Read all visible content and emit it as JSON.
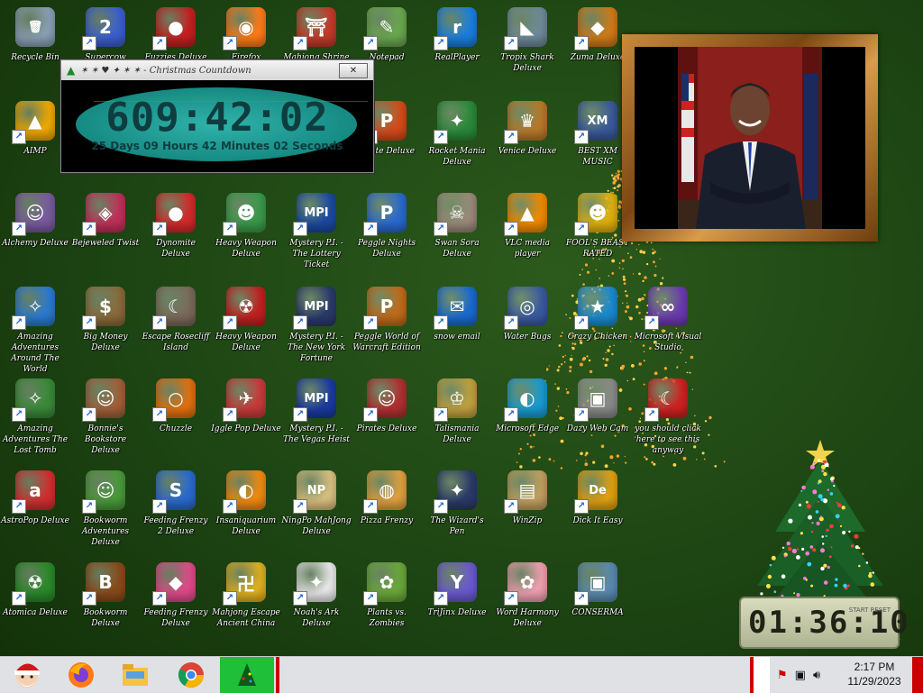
{
  "colors": {
    "desktop_bg": "#1d4413",
    "countdown_accent": "#168a83",
    "taskbar_bg": "#dfe1e5",
    "taskbar_active": "#1fbf3a",
    "frame_gold": "#b8792a"
  },
  "countdown_window": {
    "title": "✶ ✶ ♥ ✦ ✶ ✶ - Christmas Countdown",
    "close_label": "✕",
    "time": "609:42:02",
    "subtitle": "25 Days 09 Hours 42 Minutes 02 Seconds"
  },
  "desktop_icons": [
    {
      "label": "Recycle Bin",
      "icon": "recycle-bin-icon",
      "color": "#8aa0b5",
      "glyph": "🗑"
    },
    {
      "label": "Supercow Deluxe",
      "icon": "two-app-icon",
      "color": "#3b5fd0",
      "glyph": "2"
    },
    {
      "label": "Fuzzies Deluxe",
      "icon": "red-fuzzy-icon",
      "color": "#c52020",
      "glyph": "●"
    },
    {
      "label": "Firefox",
      "icon": "firefox-icon",
      "color": "#ff7a18",
      "glyph": "◉"
    },
    {
      "label": "Mahjong Shrine",
      "icon": "shrine-icon",
      "color": "#c43a2a",
      "glyph": "⛩"
    },
    {
      "label": "Notepad",
      "icon": "notepad-icon",
      "color": "#6aa84f",
      "glyph": "✎"
    },
    {
      "label": "RealPlayer",
      "icon": "realplayer-icon",
      "color": "#1a7fe0",
      "glyph": "r"
    },
    {
      "label": "Tropix Shark Deluxe",
      "icon": "shark-icon",
      "color": "#6f8a9a",
      "glyph": "◣"
    },
    {
      "label": "Zuma Deluxe",
      "icon": "zuma-icon",
      "color": "#d07a18",
      "glyph": "◆"
    },
    {
      "label": "AIMP",
      "icon": "aimp-icon",
      "color": "#f0a800",
      "glyph": "▲"
    },
    {
      "label": "Pirate Deluxe",
      "icon": "pirate-icon",
      "color": "#d64a1a",
      "glyph": "P"
    },
    {
      "label": "Rocket Mania Deluxe",
      "icon": "rocket-icon",
      "color": "#2a8a3a",
      "glyph": "✦"
    },
    {
      "label": "Venice Deluxe",
      "icon": "venice-icon",
      "color": "#b8792a",
      "glyph": "♛"
    },
    {
      "label": "BEST XM MUSIC",
      "icon": "xmplay-icon",
      "color": "#3a5a9a",
      "glyph": "XM"
    },
    {
      "label": "Alchemy Deluxe",
      "icon": "wizard-icon",
      "color": "#7a5aa0",
      "glyph": "☺"
    },
    {
      "label": "Bejeweled Twist",
      "icon": "bejeweled-icon",
      "color": "#c0305a",
      "glyph": "◈"
    },
    {
      "label": "Dynomite Deluxe",
      "icon": "dynomite-icon",
      "color": "#d22a2a",
      "glyph": "●"
    },
    {
      "label": "Heavy Weapon Deluxe",
      "icon": "gnome-icon",
      "color": "#3a9a4a",
      "glyph": "☻"
    },
    {
      "label": "Mystery P.I. - The Lottery Ticket",
      "icon": "mpi-icon",
      "color": "#1a4aa0",
      "glyph": "MPI"
    },
    {
      "label": "Peggle Nights Deluxe",
      "icon": "peggle-icon",
      "color": "#2a6ad0",
      "glyph": "P"
    },
    {
      "label": "Swan Sora Deluxe",
      "icon": "skull-icon",
      "color": "#9a8a7a",
      "glyph": "☠"
    },
    {
      "label": "VLC media player",
      "icon": "vlc-icon",
      "color": "#f08a00",
      "glyph": "▲"
    },
    {
      "label": "FOOL'S BEAST RATED",
      "icon": "alien-icon",
      "color": "#e0b010",
      "glyph": "☻"
    },
    {
      "label": "Amazing Adventures Around The World",
      "icon": "compass-icon",
      "color": "#2a7ad0",
      "glyph": "✧"
    },
    {
      "label": "Big Money Deluxe",
      "icon": "money-bag-icon",
      "color": "#8a6a3a",
      "glyph": "$"
    },
    {
      "label": "Escape Rosecliff Island",
      "icon": "moon-icon",
      "color": "#7a6a5a",
      "glyph": "☾"
    },
    {
      "label": "Heavy Weapon Deluxe",
      "icon": "radiation-icon",
      "color": "#c02020",
      "glyph": "☢"
    },
    {
      "label": "Mystery P.I. - The New York Fortune",
      "icon": "mpi-shield-icon",
      "color": "#2a3a6a",
      "glyph": "MPI"
    },
    {
      "label": "Peggle World of Warcraft Edition",
      "icon": "peggle-wow-icon",
      "color": "#c06a1a",
      "glyph": "P"
    },
    {
      "label": "snow email",
      "icon": "thunderbird-icon",
      "color": "#1a6ad0",
      "glyph": "✉"
    },
    {
      "label": "Water Bugs",
      "icon": "porthole-icon",
      "color": "#3a5aa0",
      "glyph": "◎"
    },
    {
      "label": "Crazy Chicken",
      "icon": "star-tile-icon",
      "color": "#1a8ad0",
      "glyph": "★"
    },
    {
      "label": "Microsoft Visual Studio",
      "icon": "infinity-icon",
      "color": "#6a3ab0",
      "glyph": "∞"
    },
    {
      "label": "Amazing Adventures The Lost Tomb",
      "icon": "compass-tomb-icon",
      "color": "#3a8a3a",
      "glyph": "✧"
    },
    {
      "label": "Bonnie's Bookstore Deluxe",
      "icon": "bonnie-icon",
      "color": "#a0603a",
      "glyph": "☺"
    },
    {
      "label": "Chuzzle",
      "icon": "chuzzle-ring-icon",
      "color": "#e07010",
      "glyph": "○"
    },
    {
      "label": "Iggle Pop Deluxe",
      "icon": "iggle-pop-icon",
      "color": "#c83a3a",
      "glyph": "✈"
    },
    {
      "label": "Mystery P.I. - The Vegas Heist",
      "icon": "mpi-vegas-icon",
      "color": "#1a3aa0",
      "glyph": "MPI"
    },
    {
      "label": "Pirates Deluxe",
      "icon": "pirate-kid-icon",
      "color": "#b03030",
      "glyph": "☺"
    },
    {
      "label": "Talismania Deluxe",
      "icon": "king-icon",
      "color": "#c0a040",
      "glyph": "♔"
    },
    {
      "label": "Microsoft Edge",
      "icon": "edge-icon",
      "color": "#1a9ad0",
      "glyph": "◐"
    },
    {
      "label": "Dazy Web Cam",
      "icon": "windows-stack-icon",
      "color": "#8a8a8a",
      "glyph": "▣"
    },
    {
      "label": "you should click here to see this anyway",
      "icon": "dragon-icon",
      "color": "#d02020",
      "glyph": "☾"
    },
    {
      "label": "AstroPop Deluxe",
      "icon": "astropop-icon",
      "color": "#d03030",
      "glyph": "a"
    },
    {
      "label": "Bookworm Adventures Deluxe",
      "icon": "bookworm-icon",
      "color": "#4a9a3a",
      "glyph": "☺"
    },
    {
      "label": "Feeding Frenzy 2 Deluxe",
      "icon": "fish-tile-icon",
      "color": "#2a6ad0",
      "glyph": "S"
    },
    {
      "label": "Insaniquarium Deluxe",
      "icon": "goldfish-icon",
      "color": "#f08a10",
      "glyph": "◐"
    },
    {
      "label": "NingPo MahJong Deluxe",
      "icon": "ningpo-icon",
      "color": "#d8c080",
      "glyph": "NP"
    },
    {
      "label": "Pizza Frenzy",
      "icon": "pizza-icon",
      "color": "#e0a040",
      "glyph": "◍"
    },
    {
      "label": "The Wizard's Pen",
      "icon": "wizard-pen-icon",
      "color": "#2a3a6a",
      "glyph": "✦"
    },
    {
      "label": "WinZip",
      "icon": "winzip-icon",
      "color": "#c0a060",
      "glyph": "▤"
    },
    {
      "label": "Dick It Easy",
      "icon": "de-icon",
      "color": "#e0a010",
      "glyph": "De"
    },
    {
      "label": "Atomica Deluxe",
      "icon": "atomica-icon",
      "color": "#2a8a2a",
      "glyph": "☢"
    },
    {
      "label": "Bookworm Deluxe",
      "icon": "bookworm-book-icon",
      "color": "#8a4a1a",
      "glyph": "B"
    },
    {
      "label": "Feeding Frenzy Deluxe",
      "icon": "angelfish-icon",
      "color": "#e04a8a",
      "glyph": "◆"
    },
    {
      "label": "Mahjong Escape Ancient China",
      "icon": "mahjong-tile-icon",
      "color": "#e0b020",
      "glyph": "卍"
    },
    {
      "label": "Noah's Ark Deluxe",
      "icon": "dove-icon",
      "color": "#e8e8e8",
      "glyph": "✦"
    },
    {
      "label": "Plants vs. Zombies",
      "icon": "pvz-icon",
      "color": "#6aa83a",
      "glyph": "✿"
    },
    {
      "label": "TriJinx Deluxe",
      "icon": "trijinx-icon",
      "color": "#6a5ad0",
      "glyph": "Y"
    },
    {
      "label": "Word Harmony Deluxe",
      "icon": "flower-icon",
      "color": "#f0a0b0",
      "glyph": "✿"
    },
    {
      "label": "CONSERMA",
      "icon": "window-app-icon",
      "color": "#5a8ab0",
      "glyph": "▣"
    }
  ],
  "photo_frame": {
    "label": "Picture frame"
  },
  "xmas_clock": {
    "digits": "01:36:10",
    "brand": "START RESET"
  },
  "taskbar": {
    "start_icon": "santa-start-icon",
    "pinned": [
      "firefox-icon",
      "file-explorer-icon",
      "chrome-icon",
      "christmas-tree-app-icon"
    ],
    "tray_icons": [
      "security-flag-icon",
      "network-icon",
      "speaker-icon"
    ],
    "time": "2:17 PM",
    "date": "11/29/2023"
  }
}
